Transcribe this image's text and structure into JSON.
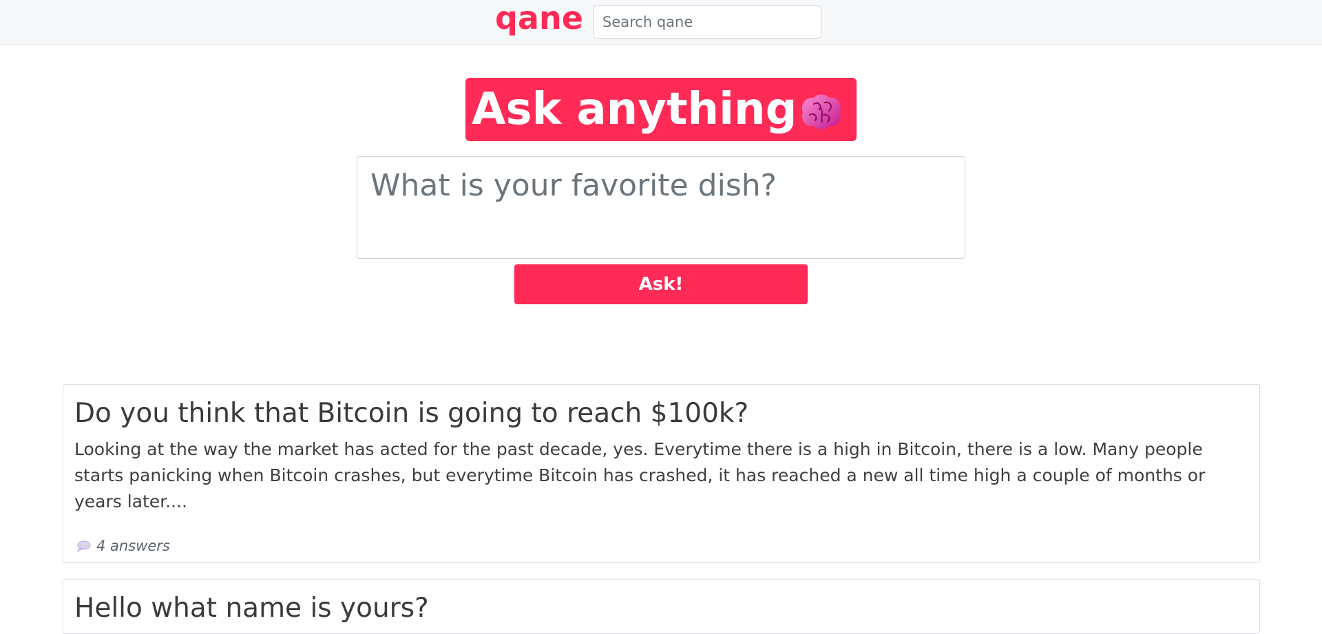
{
  "header": {
    "logo": "qane",
    "search_placeholder": "Search qane"
  },
  "hero": {
    "title": "Ask anything",
    "icon": "brain-icon",
    "accent_color": "#ff2a56"
  },
  "ask_form": {
    "placeholder": "What is your favorite dish?",
    "value": "",
    "button_label": "Ask!"
  },
  "questions": [
    {
      "title": "Do you think that Bitcoin is going to reach $100k?",
      "excerpt": "Looking at the way the market has acted for the past decade, yes. Everytime there is a high in Bitcoin, there is a low. Many people starts panicking when Bitcoin crashes, but everytime Bitcoin has crashed, it has reached a new all time high a couple of months or years later....",
      "answers_label": "4 answers",
      "icon": "speech-bubble-icon"
    },
    {
      "title": "Hello what name is yours?"
    }
  ]
}
